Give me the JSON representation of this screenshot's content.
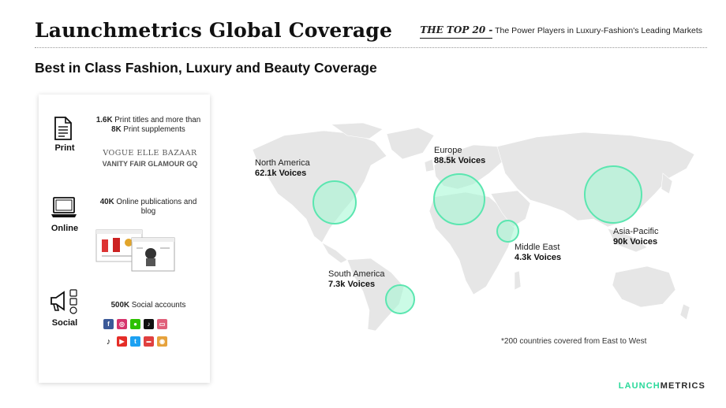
{
  "header": {
    "title": "Launchmetrics Global Coverage",
    "top20_label": "THE TOP 20 -",
    "top20_text": "The Power Players in Luxury-Fashion's Leading Markets"
  },
  "subtitle": "Best in Class Fashion, Luxury and Beauty Coverage",
  "sections": {
    "print": {
      "label": "Print",
      "count1": "1.6K",
      "text1": " Print titles and more than ",
      "count2": "8K",
      "text2": " Print supplements",
      "logos_row1": "VOGUE ELLE BAZAAR",
      "logos_row2": "VANITY FAIR GLAMOUR GQ"
    },
    "online": {
      "label": "Online",
      "count": "40K",
      "text": " Online publications and blog"
    },
    "social": {
      "label": "Social",
      "count": "500K",
      "text": " Social accounts"
    }
  },
  "regions": {
    "north_america": {
      "name": "North America",
      "voices": "62.1k Voices"
    },
    "europe": {
      "name": "Europe",
      "voices": "88.5k Voices"
    },
    "asia_pacific": {
      "name": "Asia-Pacific",
      "voices": "90k Voices"
    },
    "middle_east": {
      "name": "Middle East",
      "voices": "4.3k Voices"
    },
    "south_america": {
      "name": "South America",
      "voices": "7.3k Voices"
    }
  },
  "footnote": "*200 countries covered from East to West",
  "brand": {
    "part1": "LAUNCH",
    "part2": "METRICS"
  },
  "colors": {
    "accent": "#5be6b0",
    "bubble_fill": "#a0f8d2",
    "map": "#e6e6e6"
  }
}
